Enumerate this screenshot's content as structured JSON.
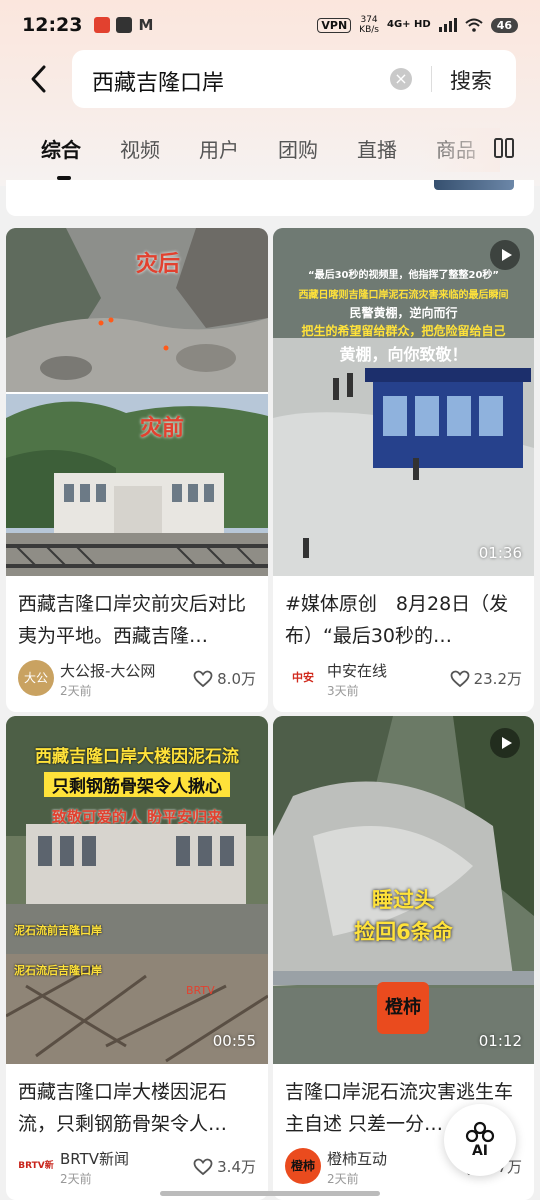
{
  "status_bar": {
    "time": "12:23",
    "vpn": "VPN",
    "speed_value": "374",
    "speed_unit": "KB/s",
    "network": "4G+ HD",
    "battery": "46"
  },
  "search": {
    "query": "西藏吉隆口岸",
    "button_label": "搜索"
  },
  "tabs": [
    {
      "label": "综合",
      "active": true
    },
    {
      "label": "视频"
    },
    {
      "label": "用户"
    },
    {
      "label": "团购"
    },
    {
      "label": "直播"
    },
    {
      "label": "商品"
    }
  ],
  "cards": [
    {
      "image_captions": {
        "top": "灾后",
        "bottom": "灾前"
      },
      "title": "西藏吉隆口岸灾前灾后对比夷为平地。西藏吉隆…",
      "author": "大公报-大公网",
      "avatar_text": "大公",
      "time": "2天前",
      "likes": "8.0万"
    },
    {
      "image_captions": {
        "line1": "“最后30秒的视频里，他指挥了整整20秒”",
        "line2": "西藏日喀则吉隆口岸泥石流灾害来临的最后瞬间",
        "line3": "民警黄棚，逆向而行",
        "line4": "把生的希望留给群众，把危险留给自己",
        "line5": "黄棚，向你致敬！"
      },
      "duration": "01:36",
      "title": "#媒体原创　8月28日（发布）“最后30秒的…",
      "author": "中安在线",
      "avatar_text": "中安",
      "time": "3天前",
      "likes": "23.2万"
    },
    {
      "image_captions": {
        "line1": "西藏吉隆口岸大楼因泥石流",
        "line2": "只剩钢筋骨架令人揪心",
        "line3": "致敬可爱的人 盼平安归来",
        "before": "泥石流前吉隆口岸",
        "after": "泥石流后吉隆口岸",
        "watermark": "BRTV"
      },
      "duration": "00:55",
      "title": "西藏吉隆口岸大楼因泥石流，只剩钢筋骨架令人…",
      "author": "BRTV新闻",
      "avatar_text": "BRTV新闻",
      "time": "2天前",
      "likes": "3.4万"
    },
    {
      "image_captions": {
        "line1": "睡过头",
        "line2": "捡回6条命",
        "logo": "橙柿"
      },
      "duration": "01:12",
      "title": "吉隆口岸泥石流灾害逃生车主自述 只差一分…",
      "author": "橙柿互动",
      "avatar_text": "橙柿",
      "time": "2天前",
      "likes": "3.7万"
    }
  ],
  "ai_button": {
    "label": "AI"
  },
  "colors": {
    "accent_red": "#e2412f",
    "caption_yellow": "#ffe23a",
    "page_bg": "#f1f1f1"
  }
}
